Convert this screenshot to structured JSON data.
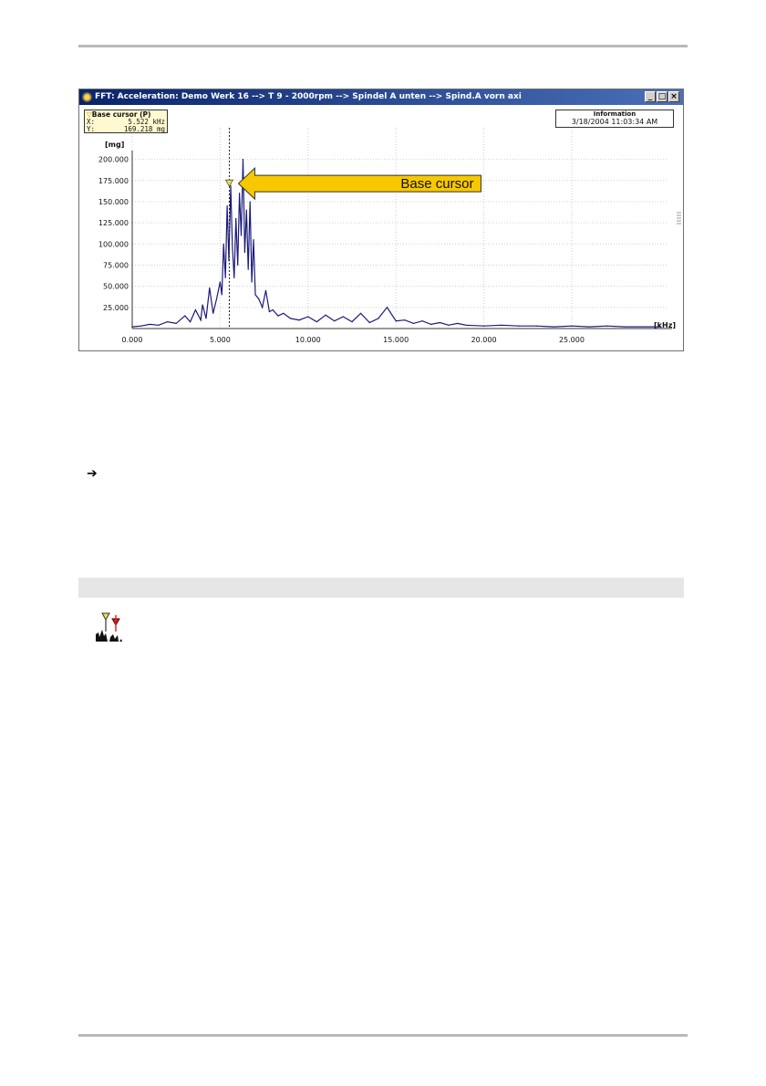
{
  "window": {
    "title": "FFT: Acceleration: Demo Werk 16 --> T 9 - 2000rpm --> Spindel A unten --> Spind.A vorn axi",
    "buttons": {
      "minimize": "_",
      "maximize": "□",
      "close": "×"
    }
  },
  "cursor_box": {
    "title": "Base cursor (P)",
    "x_label": "X:",
    "x_value": "5.522 kHz",
    "y_label": "Y:",
    "y_value": "169.218 mg"
  },
  "info_box": {
    "title": "Information",
    "timestamp": "3/18/2004 11:03:34 AM"
  },
  "callout": {
    "label": "Base cursor"
  },
  "colors": {
    "series": "#1a1a7a",
    "callout_fill": "#f7c800",
    "titlebar": "#0a246a"
  },
  "chart_data": {
    "type": "line",
    "ylabel": "[mg]",
    "xlabel": "[kHz]",
    "xlim": [
      0,
      30.5
    ],
    "ylim": [
      0,
      205
    ],
    "x_ticks": [
      "0.000",
      "5.000",
      "10.000",
      "15.000",
      "20.000",
      "25.000"
    ],
    "y_ticks": [
      "25.000",
      "50.000",
      "75.000",
      "100.000",
      "125.000",
      "150.000",
      "175.000",
      "200.000"
    ],
    "grid": true,
    "cursor": {
      "x": 5.522,
      "y": 169.218
    },
    "series": [
      {
        "x": [
          0.0,
          0.5,
          1.0,
          1.5,
          2.0,
          2.5,
          3.0,
          3.3,
          3.6,
          3.9,
          4.0,
          4.2,
          4.4,
          4.6,
          4.8,
          5.0,
          5.1,
          5.2,
          5.3,
          5.4,
          5.5,
          5.6,
          5.7,
          5.8,
          5.9,
          6.0,
          6.1,
          6.2,
          6.3,
          6.4,
          6.5,
          6.6,
          6.7,
          6.8,
          6.9,
          7.0,
          7.2,
          7.4,
          7.6,
          7.8,
          8.0,
          8.3,
          8.6,
          9.0,
          9.5,
          10.0,
          10.5,
          11.0,
          11.5,
          12.0,
          12.5,
          13.0,
          13.5,
          14.0,
          14.5,
          15.0,
          15.5,
          16.0,
          16.5,
          17.0,
          17.5,
          18.0,
          18.5,
          19.0,
          20.0,
          21.0,
          22.0,
          23.0,
          24.0,
          25.0,
          26.0,
          27.0,
          28.0,
          29.0,
          30.0
        ],
        "y": [
          2,
          3,
          5,
          4,
          8,
          6,
          15,
          8,
          22,
          10,
          28,
          12,
          48,
          18,
          35,
          55,
          40,
          100,
          60,
          145,
          80,
          169,
          95,
          60,
          130,
          75,
          160,
          110,
          200,
          90,
          140,
          70,
          150,
          55,
          105,
          40,
          35,
          25,
          45,
          20,
          22,
          15,
          18,
          12,
          10,
          14,
          8,
          16,
          9,
          14,
          8,
          18,
          7,
          12,
          25,
          9,
          10,
          6,
          9,
          5,
          7,
          4,
          6,
          4,
          3,
          4,
          3,
          3,
          2,
          3,
          2,
          3,
          2,
          2,
          2
        ]
      }
    ]
  }
}
